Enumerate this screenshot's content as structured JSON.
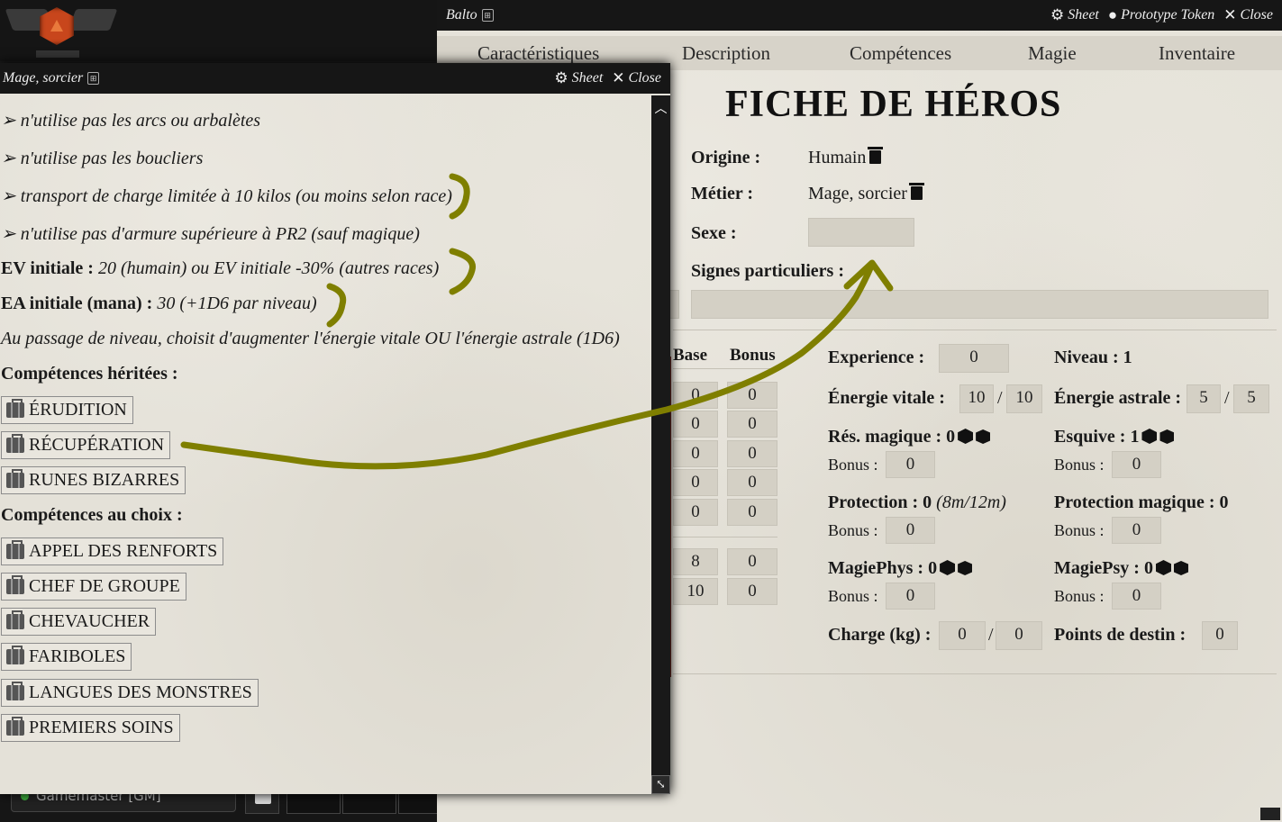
{
  "actor_window": {
    "title": "Balto",
    "header_sheet": "Sheet",
    "header_prototype": "Prototype Token",
    "header_close": "Close",
    "tabs": [
      "Caractéristiques",
      "Description",
      "Compétences",
      "Magie",
      "Inventaire"
    ],
    "sheet_title": "FICHE DE HÉROS",
    "origin_label": "Origine :",
    "origin_value": "Humain",
    "job_label": "Métier :",
    "job_value": "Mage, sorcier",
    "sex_label": "Sexe :",
    "sex_value": "",
    "signs_label": "Signes particuliers :",
    "signs_value": "",
    "stats": {
      "base_header": "Base",
      "bonus_header": "Bonus",
      "rows": [
        {
          "base": "0",
          "bonus": "0"
        },
        {
          "base": "0",
          "bonus": "0"
        },
        {
          "base": "0",
          "bonus": "0"
        },
        {
          "base": "0",
          "bonus": "0"
        },
        {
          "base": "0",
          "bonus": "0"
        },
        {
          "base": "8",
          "bonus": "0"
        },
        {
          "base": "10",
          "bonus": "0"
        }
      ]
    },
    "experience_label": "Experience :",
    "experience_value": "0",
    "level_label": "Niveau : 1",
    "ev_label": "Énergie vitale :",
    "ev_current": "10",
    "ev_max": "10",
    "ea_label": "Énergie astrale :",
    "ea_current": "5",
    "ea_max": "5",
    "res_mag_label": "Rés. magique : 0",
    "res_mag_bonus": "0",
    "dodge_label": "Esquive : 1",
    "dodge_bonus": "0",
    "protection_label": "Protection : 0",
    "protection_note": "(8m/12m)",
    "protection_bonus": "0",
    "protection_mag_label": "Protection magique : 0",
    "protection_mag_bonus": "0",
    "magiephys_label": "MagiePhys : 0",
    "magiephys_bonus": "0",
    "magiepsy_label": "MagiePsy : 0",
    "magiepsy_bonus": "0",
    "bonus_label": "Bonus :",
    "charge_label": "Charge (kg) :",
    "charge_current": "0",
    "charge_max": "0",
    "destiny_label": "Points de destin :",
    "destiny_value": "0",
    "slash": "/"
  },
  "item_window": {
    "title": "Mage, sorcier",
    "header_sheet": "Sheet",
    "header_close": "Close",
    "restrictions": [
      "➢ n'utilise pas les arcs ou arbalètes",
      "➢ n'utilise pas les boucliers",
      "➢ transport de charge limitée à 10 kilos (ou moins selon race)",
      "➢ n'utilise pas d'armure supérieure à PR2 (sauf magique)"
    ],
    "ev_init_label": "EV initiale :",
    "ev_init_text": " 20 (humain) ou EV initiale -30% (autres races)",
    "ea_init_label": "EA initiale (mana) :",
    "ea_init_text": " 30 (+1D6 par niveau)",
    "level_up_text": "Au passage de niveau, choisit d'augmenter l'énergie vitale OU l'énergie astrale (1D6)",
    "inherited_title": "Compétences héritées :",
    "inherited_skills": [
      "ÉRUDITION",
      "RÉCUPÉRATION",
      "RUNES BIZARRES"
    ],
    "choice_title": "Compétences au choix :",
    "choice_skills": [
      "APPEL DES RENFORTS",
      "CHEF DE GROUPE",
      "CHEVAUCHER",
      "FARIBOLES",
      "LANGUES DES MONSTRES",
      "PREMIERS SOINS"
    ]
  },
  "players": {
    "gm_name": "Gamemaster [GM]"
  },
  "colors": {
    "annotation": "#7f7f00",
    "parchment": "#e4e1d8",
    "header_bg": "#161616",
    "stat_bar": "#7b2a24"
  },
  "icons": [
    "foundry-logo-icon",
    "gear-icon",
    "user-icon",
    "close-icon",
    "trash-icon",
    "d20-icon",
    "d6-icon",
    "suitcase-icon",
    "document-icon",
    "resize-icon"
  ]
}
